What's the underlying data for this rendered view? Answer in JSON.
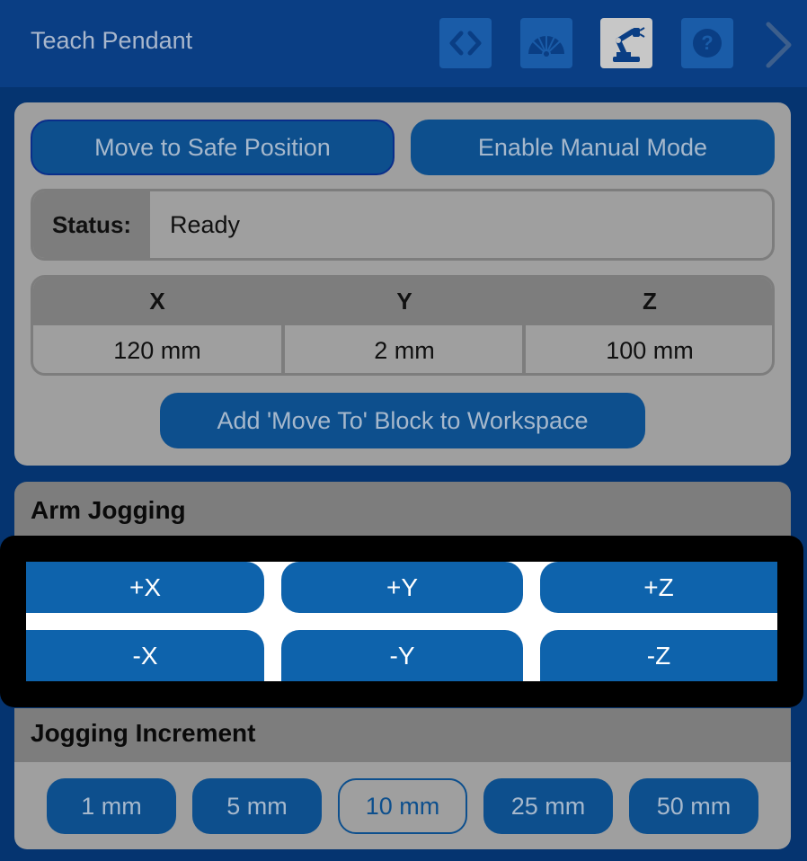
{
  "header": {
    "title": "Teach Pendant",
    "icons": [
      "code-icon",
      "gauge-icon",
      "robot-arm-icon",
      "help-icon",
      "chevron-right-icon"
    ]
  },
  "actions": {
    "safe_position": "Move to Safe Position",
    "manual_mode": "Enable Manual Mode",
    "add_block": "Add 'Move To' Block to Workspace"
  },
  "status": {
    "label": "Status:",
    "value": "Ready"
  },
  "coordinates": {
    "headers": [
      "X",
      "Y",
      "Z"
    ],
    "values": [
      "120 mm",
      "2 mm",
      "100 mm"
    ]
  },
  "jogging": {
    "title": "Arm Jogging",
    "buttons": [
      "+X",
      "+Y",
      "+Z",
      "-X",
      "-Y",
      "-Z"
    ]
  },
  "increment": {
    "title": "Jogging Increment",
    "options": [
      "1 mm",
      "5 mm",
      "10 mm",
      "25 mm",
      "50 mm"
    ],
    "selected": "10 mm"
  },
  "colors": {
    "header_bg": "#0a3e84",
    "button_bg": "#0d4f8d",
    "jog_button_bg": "#0e63ac",
    "panel_bg": "#9f9f9f"
  }
}
